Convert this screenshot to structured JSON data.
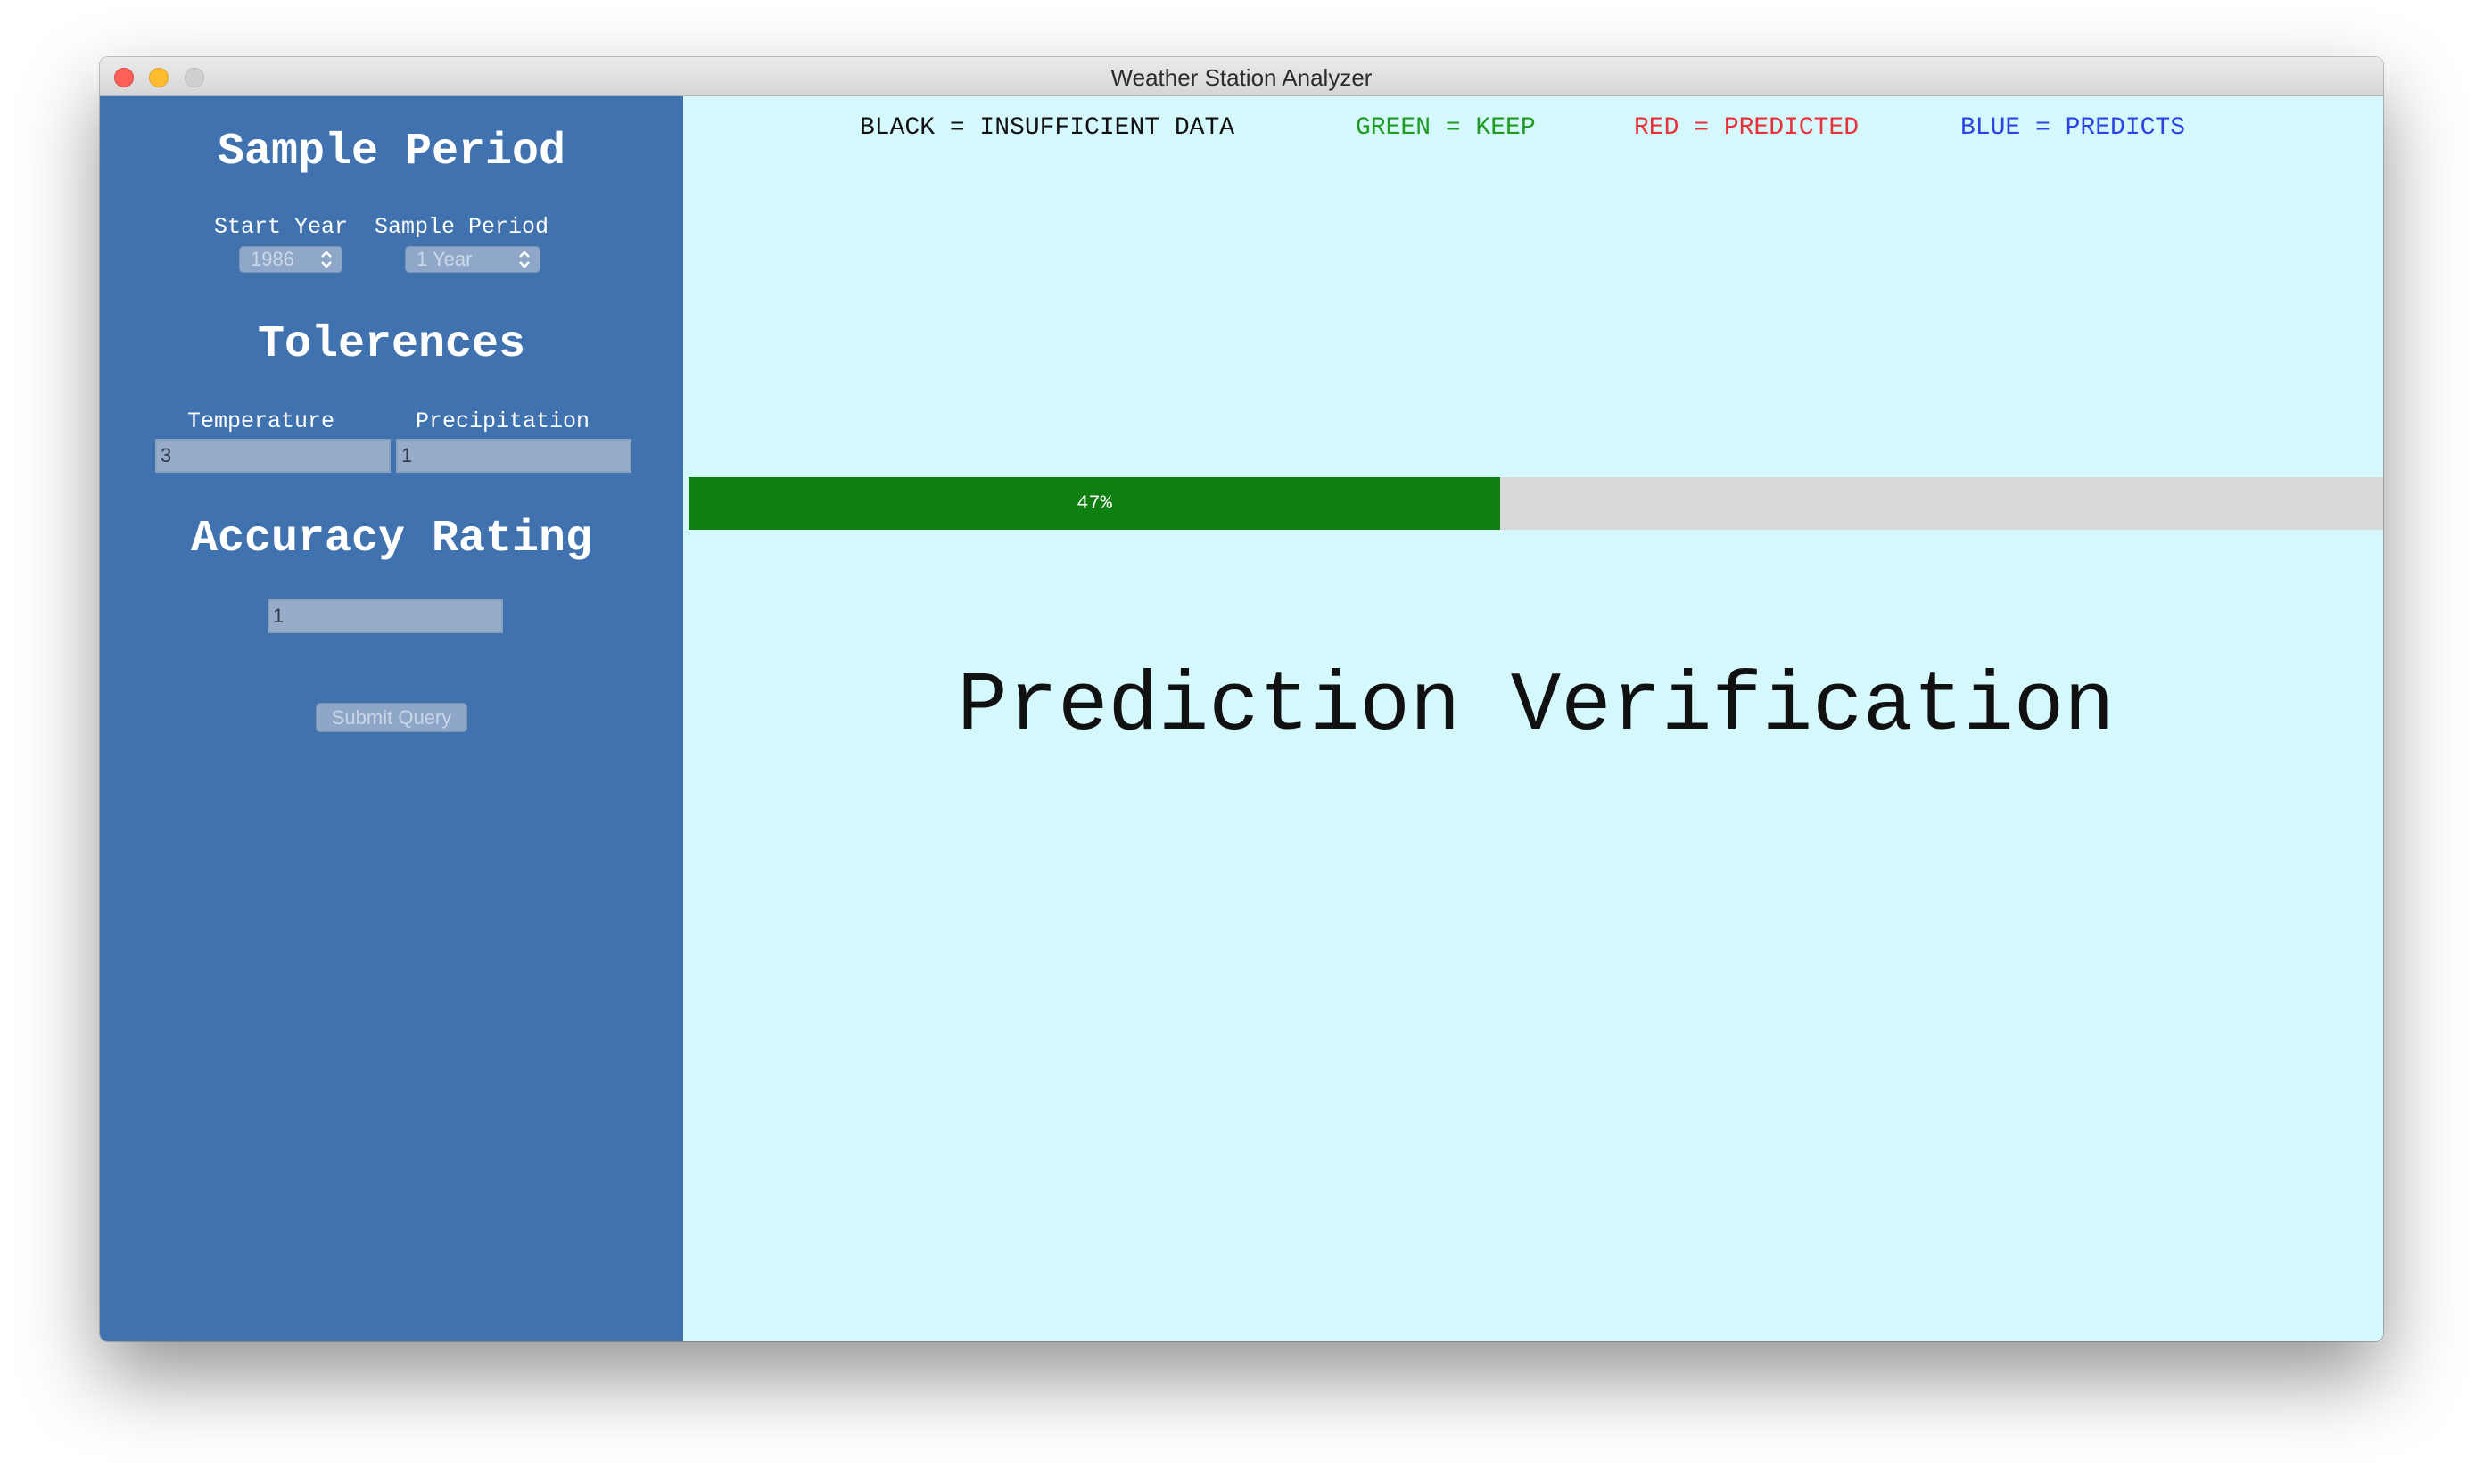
{
  "window": {
    "title": "Weather Station Analyzer"
  },
  "sidebar": {
    "sample_period": {
      "heading": "Sample Period",
      "start_year_label": "Start Year",
      "start_year_value": "1986",
      "period_label": "Sample Period",
      "period_value": "1 Year"
    },
    "tolerences": {
      "heading": "Tolerences",
      "temperature_label": "Temperature",
      "temperature_value": "3",
      "precipitation_label": "Precipitation",
      "precipitation_value": "1"
    },
    "accuracy": {
      "heading": "Accuracy Rating",
      "value": "1"
    },
    "submit_label": "Submit Query"
  },
  "legend": {
    "black": "BLACK = INSUFFICIENT DATA",
    "green": "GREEN = KEEP",
    "red": "RED = PREDICTED",
    "blue": "BLUE = PREDICTS"
  },
  "progress": {
    "fraction": 0.479,
    "label": "47%"
  },
  "main": {
    "title": "Prediction Verification"
  },
  "colors": {
    "sidebar_bg": "#4072b0",
    "main_bg": "#d5f8fc",
    "progress_fill": "#0f7f12",
    "legend_black": "#111111",
    "legend_green": "#1f9b24",
    "legend_red": "#e8323a",
    "legend_blue": "#2b44e6"
  },
  "icons": {
    "select_arrows": "chevron-up-down-icon"
  }
}
